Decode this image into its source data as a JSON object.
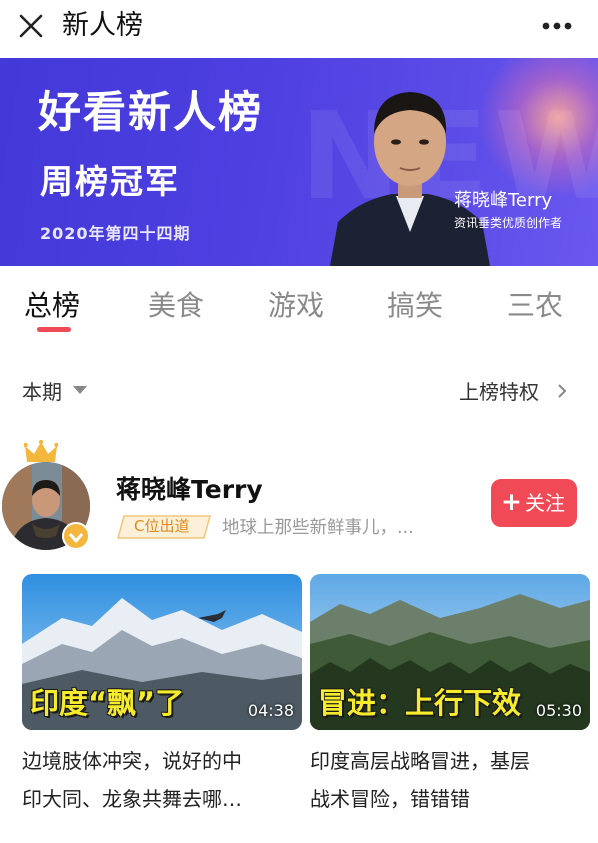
{
  "header": {
    "title": "新人榜",
    "close_icon": "close-icon",
    "more_icon": "more-icon"
  },
  "banner": {
    "watermark": "NEW",
    "title": "好看新人榜",
    "subtitle": "周榜冠军",
    "issue": "2020年第四十四期",
    "person_name": "蒋晓峰Terry",
    "person_role": "资讯垂类优质创作者"
  },
  "tabs": [
    {
      "label": "总榜",
      "active": true
    },
    {
      "label": "美食",
      "active": false
    },
    {
      "label": "游戏",
      "active": false
    },
    {
      "label": "搞笑",
      "active": false
    },
    {
      "label": "三农",
      "active": false
    }
  ],
  "filter": {
    "period": "本期",
    "privilege": "上榜特权"
  },
  "creator": {
    "name": "蒋晓峰Terry",
    "badge": "C位出道",
    "description": "地球上那些新鲜事儿，...",
    "follow_label": "关注",
    "follow_plus": "+"
  },
  "videos": [
    {
      "caption": "印度“飘”了",
      "duration": "04:38",
      "title_line1": "边境肢体冲突，说好的中",
      "title_line2": "印大同、龙象共舞去哪…"
    },
    {
      "caption": "冒进：上行下效",
      "duration": "05:30",
      "title_line1": "印度高层战略冒进，基层",
      "title_line2": "战术冒险，错错错"
    }
  ],
  "colors": {
    "accent": "#f04a56",
    "banner": "#4a3de0",
    "caption": "#f7ec2b",
    "badge": "#e08a1e"
  }
}
